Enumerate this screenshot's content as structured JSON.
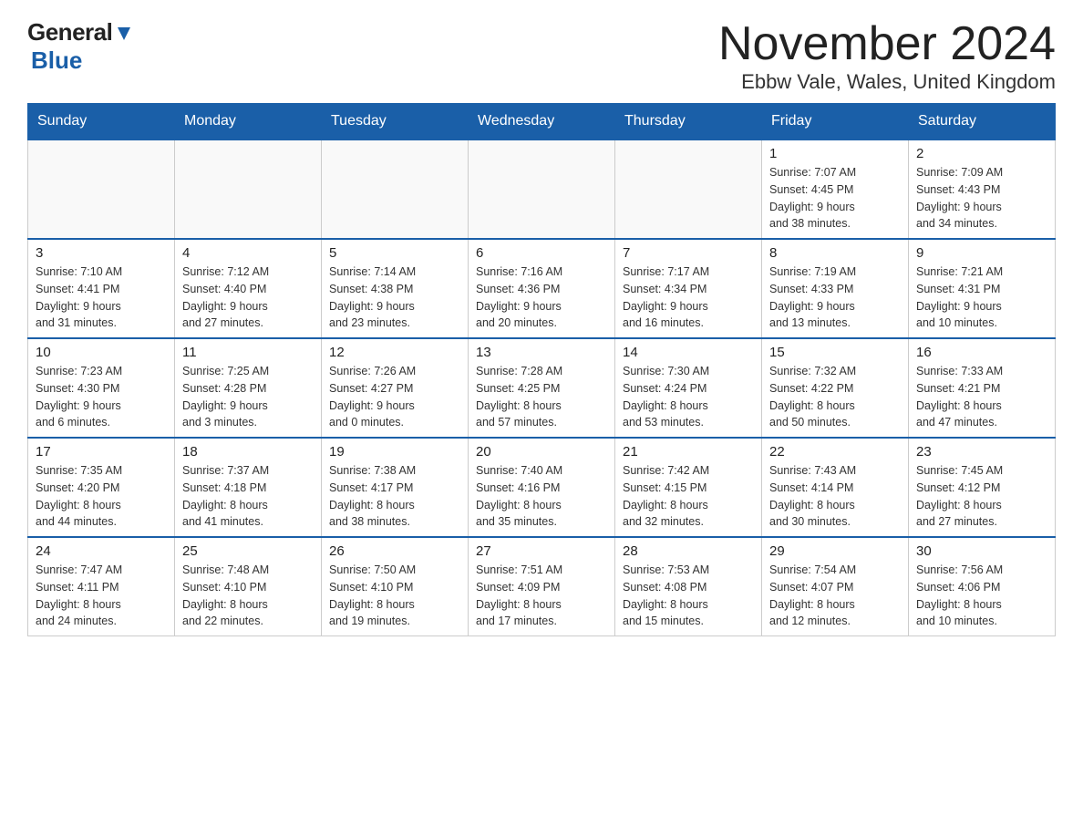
{
  "header": {
    "title": "November 2024",
    "subtitle": "Ebbw Vale, Wales, United Kingdom"
  },
  "logo": {
    "line1": "General",
    "line2": "Blue"
  },
  "days_header": [
    "Sunday",
    "Monday",
    "Tuesday",
    "Wednesday",
    "Thursday",
    "Friday",
    "Saturday"
  ],
  "weeks": [
    {
      "days": [
        {
          "num": "",
          "info": ""
        },
        {
          "num": "",
          "info": ""
        },
        {
          "num": "",
          "info": ""
        },
        {
          "num": "",
          "info": ""
        },
        {
          "num": "",
          "info": ""
        },
        {
          "num": "1",
          "info": "Sunrise: 7:07 AM\nSunset: 4:45 PM\nDaylight: 9 hours\nand 38 minutes."
        },
        {
          "num": "2",
          "info": "Sunrise: 7:09 AM\nSunset: 4:43 PM\nDaylight: 9 hours\nand 34 minutes."
        }
      ]
    },
    {
      "days": [
        {
          "num": "3",
          "info": "Sunrise: 7:10 AM\nSunset: 4:41 PM\nDaylight: 9 hours\nand 31 minutes."
        },
        {
          "num": "4",
          "info": "Sunrise: 7:12 AM\nSunset: 4:40 PM\nDaylight: 9 hours\nand 27 minutes."
        },
        {
          "num": "5",
          "info": "Sunrise: 7:14 AM\nSunset: 4:38 PM\nDaylight: 9 hours\nand 23 minutes."
        },
        {
          "num": "6",
          "info": "Sunrise: 7:16 AM\nSunset: 4:36 PM\nDaylight: 9 hours\nand 20 minutes."
        },
        {
          "num": "7",
          "info": "Sunrise: 7:17 AM\nSunset: 4:34 PM\nDaylight: 9 hours\nand 16 minutes."
        },
        {
          "num": "8",
          "info": "Sunrise: 7:19 AM\nSunset: 4:33 PM\nDaylight: 9 hours\nand 13 minutes."
        },
        {
          "num": "9",
          "info": "Sunrise: 7:21 AM\nSunset: 4:31 PM\nDaylight: 9 hours\nand 10 minutes."
        }
      ]
    },
    {
      "days": [
        {
          "num": "10",
          "info": "Sunrise: 7:23 AM\nSunset: 4:30 PM\nDaylight: 9 hours\nand 6 minutes."
        },
        {
          "num": "11",
          "info": "Sunrise: 7:25 AM\nSunset: 4:28 PM\nDaylight: 9 hours\nand 3 minutes."
        },
        {
          "num": "12",
          "info": "Sunrise: 7:26 AM\nSunset: 4:27 PM\nDaylight: 9 hours\nand 0 minutes."
        },
        {
          "num": "13",
          "info": "Sunrise: 7:28 AM\nSunset: 4:25 PM\nDaylight: 8 hours\nand 57 minutes."
        },
        {
          "num": "14",
          "info": "Sunrise: 7:30 AM\nSunset: 4:24 PM\nDaylight: 8 hours\nand 53 minutes."
        },
        {
          "num": "15",
          "info": "Sunrise: 7:32 AM\nSunset: 4:22 PM\nDaylight: 8 hours\nand 50 minutes."
        },
        {
          "num": "16",
          "info": "Sunrise: 7:33 AM\nSunset: 4:21 PM\nDaylight: 8 hours\nand 47 minutes."
        }
      ]
    },
    {
      "days": [
        {
          "num": "17",
          "info": "Sunrise: 7:35 AM\nSunset: 4:20 PM\nDaylight: 8 hours\nand 44 minutes."
        },
        {
          "num": "18",
          "info": "Sunrise: 7:37 AM\nSunset: 4:18 PM\nDaylight: 8 hours\nand 41 minutes."
        },
        {
          "num": "19",
          "info": "Sunrise: 7:38 AM\nSunset: 4:17 PM\nDaylight: 8 hours\nand 38 minutes."
        },
        {
          "num": "20",
          "info": "Sunrise: 7:40 AM\nSunset: 4:16 PM\nDaylight: 8 hours\nand 35 minutes."
        },
        {
          "num": "21",
          "info": "Sunrise: 7:42 AM\nSunset: 4:15 PM\nDaylight: 8 hours\nand 32 minutes."
        },
        {
          "num": "22",
          "info": "Sunrise: 7:43 AM\nSunset: 4:14 PM\nDaylight: 8 hours\nand 30 minutes."
        },
        {
          "num": "23",
          "info": "Sunrise: 7:45 AM\nSunset: 4:12 PM\nDaylight: 8 hours\nand 27 minutes."
        }
      ]
    },
    {
      "days": [
        {
          "num": "24",
          "info": "Sunrise: 7:47 AM\nSunset: 4:11 PM\nDaylight: 8 hours\nand 24 minutes."
        },
        {
          "num": "25",
          "info": "Sunrise: 7:48 AM\nSunset: 4:10 PM\nDaylight: 8 hours\nand 22 minutes."
        },
        {
          "num": "26",
          "info": "Sunrise: 7:50 AM\nSunset: 4:10 PM\nDaylight: 8 hours\nand 19 minutes."
        },
        {
          "num": "27",
          "info": "Sunrise: 7:51 AM\nSunset: 4:09 PM\nDaylight: 8 hours\nand 17 minutes."
        },
        {
          "num": "28",
          "info": "Sunrise: 7:53 AM\nSunset: 4:08 PM\nDaylight: 8 hours\nand 15 minutes."
        },
        {
          "num": "29",
          "info": "Sunrise: 7:54 AM\nSunset: 4:07 PM\nDaylight: 8 hours\nand 12 minutes."
        },
        {
          "num": "30",
          "info": "Sunrise: 7:56 AM\nSunset: 4:06 PM\nDaylight: 8 hours\nand 10 minutes."
        }
      ]
    }
  ]
}
